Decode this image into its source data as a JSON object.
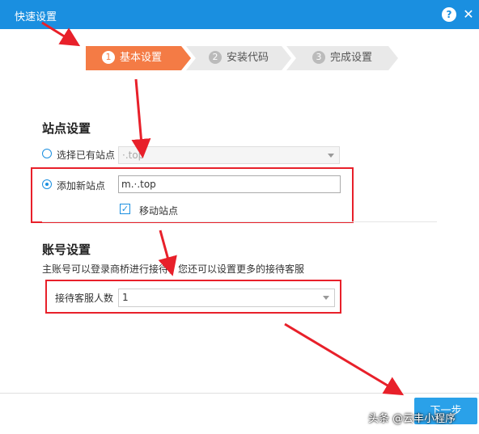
{
  "window": {
    "title": "快速设置",
    "help": "?",
    "close": "✕"
  },
  "steps": [
    {
      "num": "1",
      "label": "基本设置"
    },
    {
      "num": "2",
      "label": "安装代码"
    },
    {
      "num": "3",
      "label": "完成设置"
    }
  ],
  "site": {
    "section_title": "站点设置",
    "existing_label": "选择已有站点",
    "existing_value": "·.top",
    "add_label": "添加新站点",
    "add_value": "m.·.top",
    "mobile_label": "移动站点",
    "mobile_checked": "✓"
  },
  "account": {
    "section_title": "账号设置",
    "description": "主账号可以登录商桥进行接待，您还可以设置更多的接待客服",
    "staff_label": "接待客服人数",
    "staff_value": "1"
  },
  "footer": {
    "next_label": "下一步"
  },
  "watermark": "头条 @云丰小程序",
  "colors": {
    "titlebar": "#1a8fe0",
    "active_step": "#f47b45",
    "annotation": "#e8202a",
    "next_button": "#2aa1e9"
  }
}
